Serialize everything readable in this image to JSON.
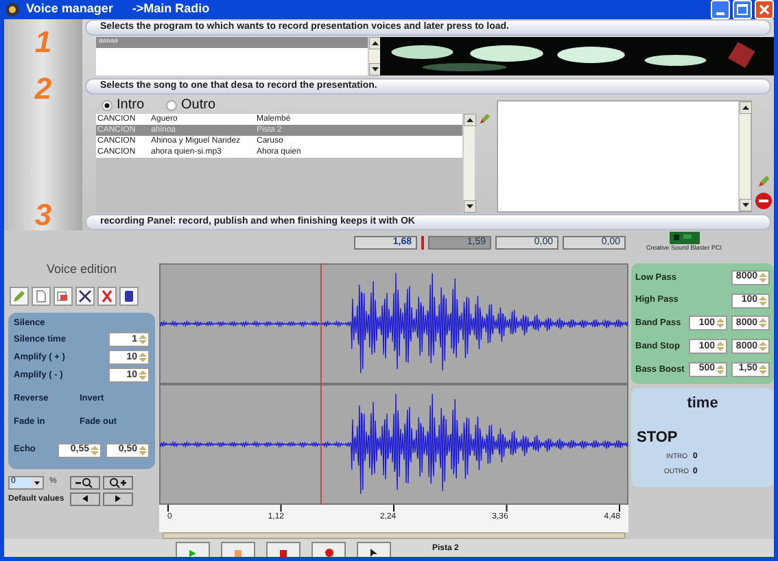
{
  "window": {
    "title": "Voice manager",
    "subtitle": "->Main Radio"
  },
  "steps": [
    {
      "number": "1",
      "instruction": "Selects the program to which wants to record presentation voices and later press to load."
    },
    {
      "number": "2",
      "instruction": "Selects the song to one that desa to record the presentation."
    },
    {
      "number": "3",
      "instruction": "recording Panel: record, publish and when finishing keeps it with OK"
    }
  ],
  "programs": [
    {
      "label": "aaaaa",
      "selected": true
    }
  ],
  "options": [
    {
      "label": "Intro",
      "selected": true
    },
    {
      "label": "Outro",
      "selected": false
    }
  ],
  "songs": [
    {
      "type": "CANCION",
      "title": "Aguero",
      "artist": "Malembé",
      "selected": false
    },
    {
      "type": "CANCION",
      "title": "ahinoa",
      "artist": "Pista 2",
      "selected": true
    },
    {
      "type": "CANCION",
      "title": "Ahinoa y Miguel Nandez",
      "artist": "Caruso",
      "selected": false
    },
    {
      "type": "CANCION",
      "title": "ahora quien-si.mp3",
      "artist": "Ahora quien",
      "selected": false
    }
  ],
  "readouts": [
    "1,68",
    "1,59",
    "0,00",
    "0,00"
  ],
  "sound_card": "Creative Sound Blaster PCI",
  "voice_edition": {
    "title": "Voice edition",
    "section": "Silence",
    "rows": [
      {
        "kind": "spin",
        "label": "Silence time",
        "values": [
          "1"
        ]
      },
      {
        "kind": "spin",
        "label": "Amplify ( + )",
        "values": [
          "10"
        ]
      },
      {
        "kind": "spin",
        "label": "Amplify ( - )",
        "values": [
          "10"
        ]
      },
      {
        "kind": "pair",
        "labels": [
          "Reverse",
          "Invert"
        ]
      },
      {
        "kind": "pair",
        "labels": [
          "Fade in",
          "Fade out"
        ]
      },
      {
        "kind": "spin",
        "label": "Echo",
        "values": [
          "0,55",
          "0,50"
        ]
      }
    ]
  },
  "zoom": {
    "value": "0",
    "unit": "%",
    "default_label": "Default values"
  },
  "filters": [
    {
      "label": "Low Pass",
      "values": [
        "8000"
      ]
    },
    {
      "label": "High Pass",
      "values": [
        "100"
      ]
    },
    {
      "label": "Band Pass",
      "values": [
        "100",
        "8000"
      ]
    },
    {
      "label": "Band Stop",
      "values": [
        "100",
        "8000"
      ]
    },
    {
      "label": "Bass Boost",
      "values": [
        "500",
        "1,50"
      ]
    }
  ],
  "time": {
    "title": "time",
    "state": "STOP",
    "counters": [
      {
        "label": "INTRO",
        "value": "0"
      },
      {
        "label": "OUTRO",
        "value": "0"
      }
    ]
  },
  "axis": [
    "0",
    "1,12",
    "2,24",
    "3,36",
    "4,48"
  ],
  "track": "Pista 2"
}
